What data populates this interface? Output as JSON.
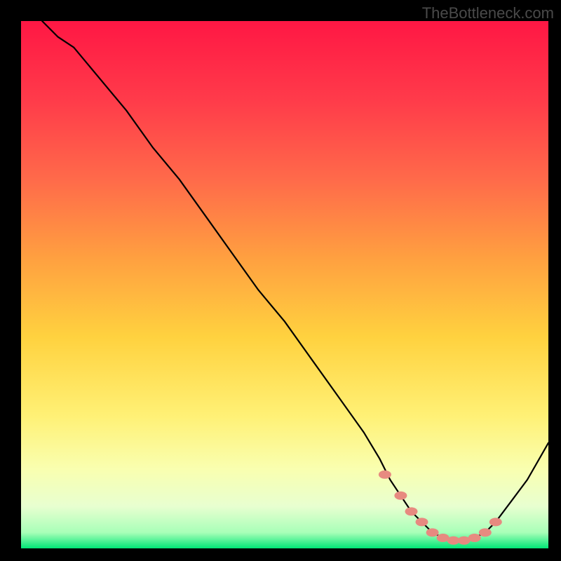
{
  "watermark": "TheBottleneck.com",
  "chart_data": {
    "type": "line",
    "title": "",
    "xlabel": "",
    "ylabel": "",
    "xlim": [
      0,
      100
    ],
    "ylim": [
      0,
      100
    ],
    "series": [
      {
        "name": "bottleneck-curve",
        "x": [
          4,
          7,
          10,
          15,
          20,
          25,
          30,
          35,
          40,
          45,
          50,
          55,
          60,
          65,
          68,
          70,
          72,
          74,
          76,
          78,
          80,
          82,
          84,
          86,
          88,
          90,
          93,
          96,
          100
        ],
        "y": [
          100,
          97,
          95,
          89,
          83,
          76,
          70,
          63,
          56,
          49,
          43,
          36,
          29,
          22,
          17,
          13,
          10,
          7,
          5,
          3,
          2,
          1.5,
          1.5,
          2,
          3,
          5,
          9,
          13,
          20
        ]
      }
    ],
    "markers": {
      "name": "optimal-range-markers",
      "x": [
        69,
        72,
        74,
        76,
        78,
        80,
        82,
        84,
        86,
        88,
        90
      ],
      "y": [
        14,
        10,
        7,
        5,
        3,
        2,
        1.5,
        1.5,
        2,
        3,
        5
      ]
    },
    "gradient_stops": [
      {
        "pos": 0.0,
        "color": "#ff1744"
      },
      {
        "pos": 0.15,
        "color": "#ff3b4a"
      },
      {
        "pos": 0.3,
        "color": "#ff6a4a"
      },
      {
        "pos": 0.45,
        "color": "#ffa040"
      },
      {
        "pos": 0.6,
        "color": "#ffd23f"
      },
      {
        "pos": 0.75,
        "color": "#fff176"
      },
      {
        "pos": 0.85,
        "color": "#f9ffb0"
      },
      {
        "pos": 0.92,
        "color": "#e8ffd0"
      },
      {
        "pos": 0.97,
        "color": "#a8ffb8"
      },
      {
        "pos": 1.0,
        "color": "#00e676"
      }
    ]
  }
}
